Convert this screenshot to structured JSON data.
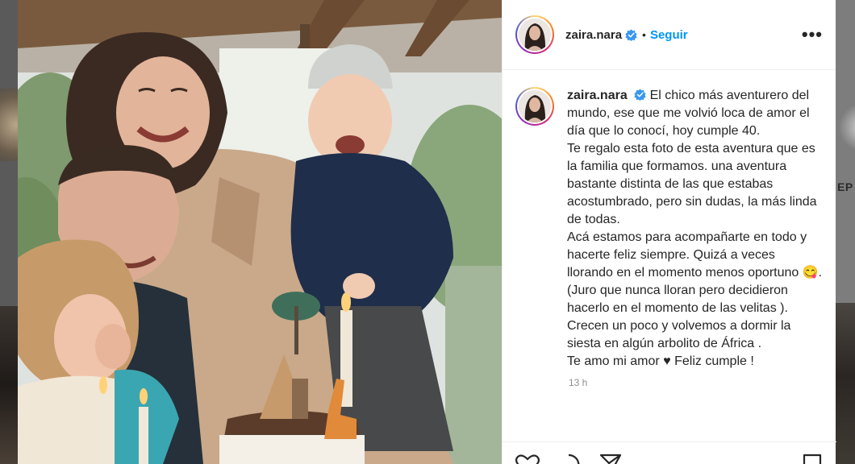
{
  "post": {
    "username": "zaira.nara",
    "follow_label": "Seguir",
    "separator": "•",
    "more_label": "•••",
    "caption_username": "zaira.nara",
    "caption": "El chico más aventurero del mundo, ese que me volvió loca de amor el día que lo conocí, hoy cumple 40.\nTe regalo esta foto de esta aventura que es la familia que formamos. una aventura bastante distinta de las que estabas acostumbrado, pero sin dudas, la más linda de todas.\nAcá estamos para acompañarte en todo y hacerte feliz siempre. Quizá a veces llorando en el momento menos oportuno 😋.\n(Juro que nunca lloran pero decidieron hacerlo en el momento de las velitas ).\nCrecen un poco y volvemos a dormir la siesta en algún arbolito de África .\nTe amo mi amor ♥ Feliz cumple !",
    "timestamp": "13 h"
  },
  "background": {
    "right_partial_text": "EP"
  },
  "icons": {
    "verified": "verified-badge-icon",
    "like": "heart-icon",
    "comment": "comment-icon",
    "share": "paper-plane-icon",
    "save": "bookmark-icon"
  },
  "colors": {
    "follow": "#0095f6",
    "verified": "#3897f0",
    "text": "#262626",
    "muted": "#8e8e8e"
  }
}
